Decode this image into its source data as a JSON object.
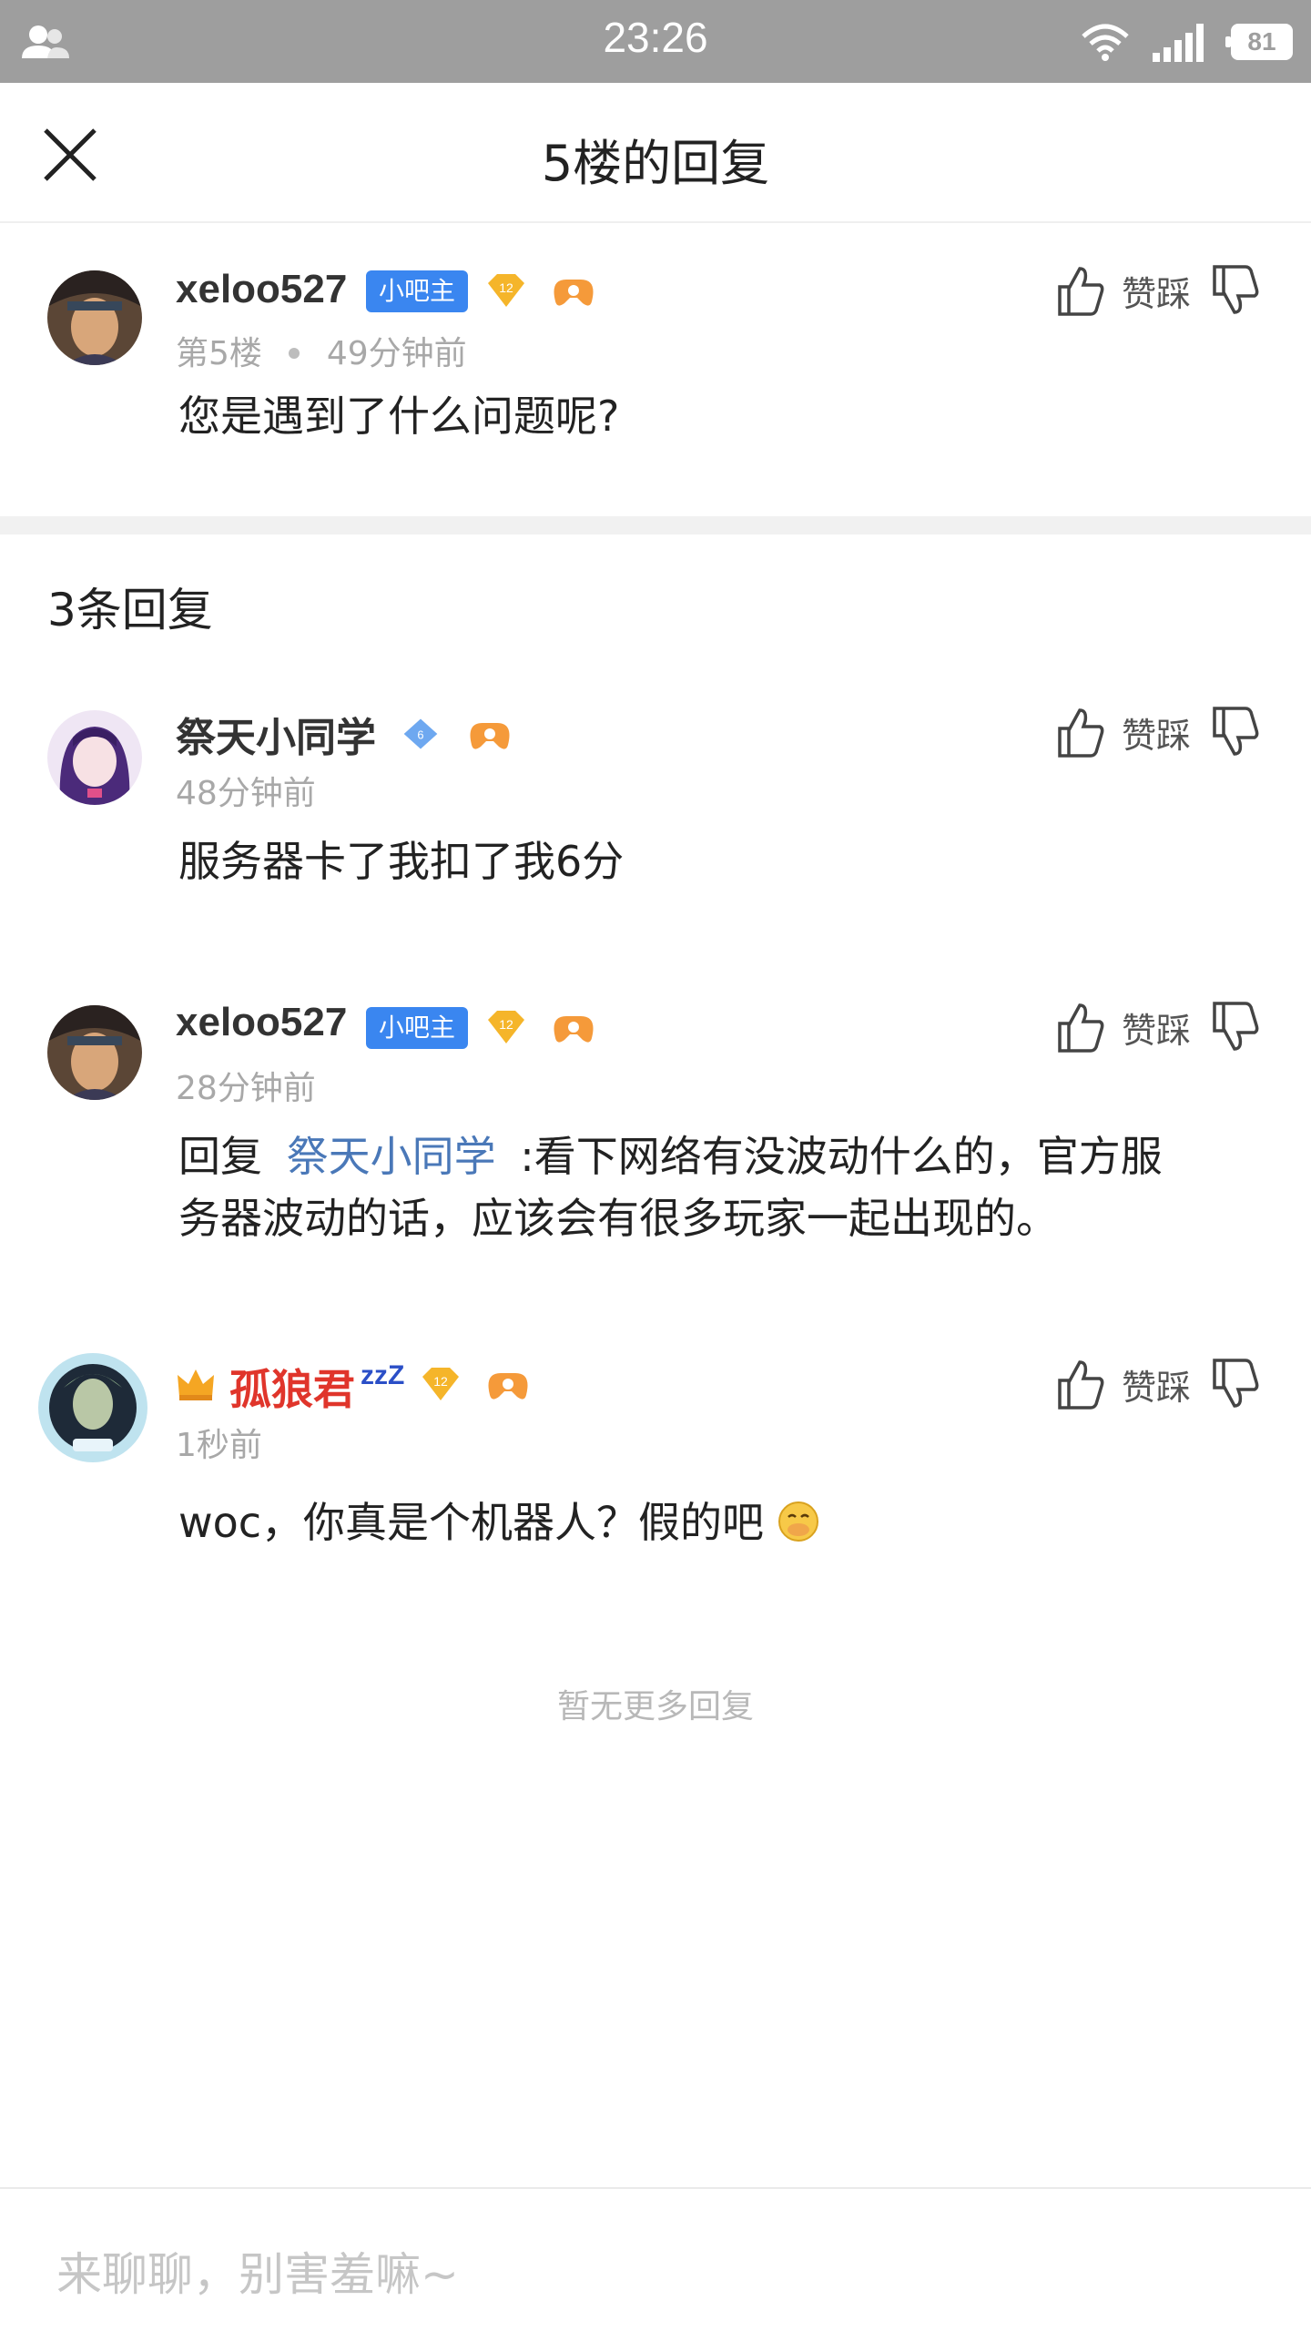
{
  "status_bar": {
    "time": "23:26",
    "battery": "81"
  },
  "header": {
    "title": "5楼的回复"
  },
  "main_post": {
    "username": "xeloo527",
    "badge": "小吧主",
    "level": "12",
    "floor": "第5楼",
    "time": "49分钟前",
    "content": "您是遇到了什么问题呢?",
    "action_label": "赞踩"
  },
  "replies_count": "3条回复",
  "replies": [
    {
      "username": "祭天小同学",
      "level": "6",
      "time": "48分钟前",
      "content": "服务器卡了我扣了我6分",
      "action_label": "赞踩"
    },
    {
      "username": "xeloo527",
      "badge": "小吧主",
      "level": "12",
      "time": "28分钟前",
      "reply_prefix": "回复",
      "reply_to": "祭天小同学",
      "content_line1": ":看下网络有没波动什么的，官方服",
      "content_line2": "务器波动的话，应该会有很多玩家一起出现的。",
      "action_label": "赞踩"
    },
    {
      "username": "孤狼君",
      "zzz": "zzZ",
      "level": "12",
      "time": "1秒前",
      "content": "woc，你真是个机器人？假的吧",
      "action_label": "赞踩"
    }
  ],
  "no_more": "暂无更多回复",
  "input": {
    "placeholder": "来聊聊，别害羞嘛~"
  },
  "colors": {
    "badge_blue": "#3a86f0",
    "mention_blue": "#4a78b8",
    "red_name": "#e0352b"
  }
}
